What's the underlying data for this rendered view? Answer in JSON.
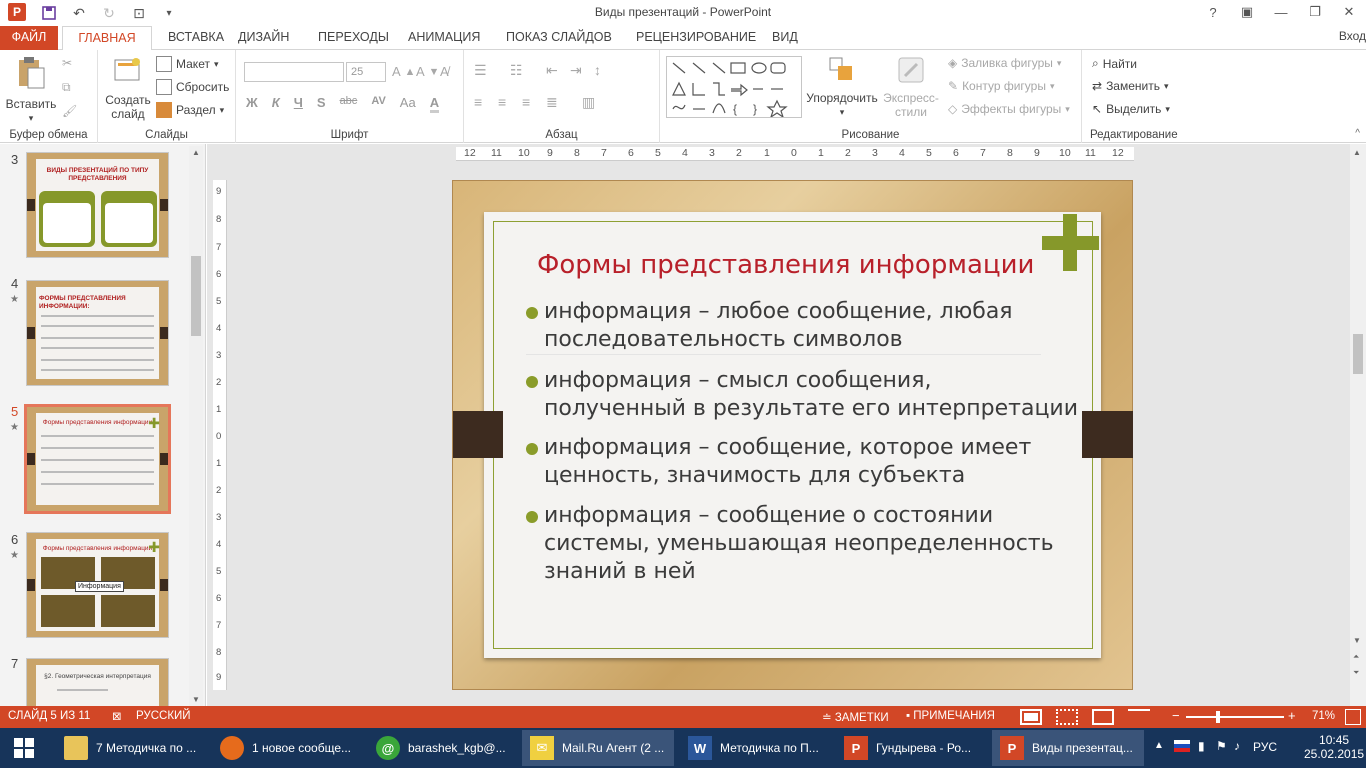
{
  "window": {
    "title": "Виды презентаций - PowerPoint",
    "signin": "Вход"
  },
  "tabs": {
    "file": "ФАЙЛ",
    "items": [
      "ГЛАВНАЯ",
      "ВСТАВКА",
      "ДИЗАЙН",
      "ПЕРЕХОДЫ",
      "АНИМАЦИЯ",
      "ПОКАЗ СЛАЙДОВ",
      "РЕЦЕНЗИРОВАНИЕ",
      "ВИД"
    ]
  },
  "ribbon": {
    "clipboard": {
      "label": "Буфер обмена",
      "paste": "Вставить"
    },
    "slides": {
      "label": "Слайды",
      "new_slide": "Создать слайд",
      "layout": "Макет",
      "reset": "Сбросить",
      "section": "Раздел"
    },
    "font": {
      "label": "Шрифт",
      "font_name": "",
      "font_size": "25",
      "bold": "Ж",
      "italic": "К",
      "underline": "Ч",
      "strike": "S",
      "abc": "abc",
      "spacing": "AV",
      "case": "Aa"
    },
    "paragraph": {
      "label": "Абзац"
    },
    "drawing": {
      "label": "Рисование",
      "arrange": "Упорядочить",
      "quick_styles": "Экспресс-стили",
      "fill": "Заливка фигуры",
      "outline": "Контур фигуры",
      "effects": "Эффекты фигуры"
    },
    "editing": {
      "label": "Редактирование",
      "find": "Найти",
      "replace": "Заменить",
      "select": "Выделить"
    }
  },
  "thumbnails": [
    {
      "num": "3",
      "title": "ВИДЫ ПРЕЗЕНТАЦИЙ ПО ТИПУ ПРЕДСТАВЛЕНИЯ",
      "star": false
    },
    {
      "num": "4",
      "title": "ФОРМЫ ПРЕДСТАВЛЕНИЯ ИНФОРМАЦИИ:",
      "star": true
    },
    {
      "num": "5",
      "title": "Формы представления информации",
      "star": true,
      "selected": true
    },
    {
      "num": "6",
      "title": "Формы представления информации",
      "star": true,
      "callout": "Информация"
    },
    {
      "num": "7",
      "title": "§2. Геометрическая интерпретация",
      "star": false
    }
  ],
  "ruler": {
    "h": [
      "12",
      "11",
      "10",
      "9",
      "8",
      "7",
      "6",
      "5",
      "4",
      "3",
      "2",
      "1",
      "0",
      "1",
      "2",
      "3",
      "4",
      "5",
      "6",
      "7",
      "8",
      "9",
      "10",
      "11",
      "12"
    ],
    "v": [
      "9",
      "8",
      "7",
      "6",
      "5",
      "4",
      "3",
      "2",
      "1",
      "0",
      "1",
      "2",
      "3",
      "4",
      "5",
      "6",
      "7",
      "8",
      "9"
    ]
  },
  "slide": {
    "title": "Формы представления информации",
    "bullets": [
      {
        "line1": "информация – любое сообщение, любая",
        "line2": "последовательность символов"
      },
      {
        "line1": "информация – смысл сообщения,",
        "line2": "полученный в результате его интерпретации"
      },
      {
        "line1": "информация – сообщение, которое имеет",
        "line2": "ценность, значимость для субъекта"
      },
      {
        "line1": "информация – сообщение о состоянии",
        "line2": "системы, уменьшающая неопределенность",
        "line3": "знаний в ней"
      }
    ],
    "accent": "#86982a",
    "title_color": "#b8202a"
  },
  "status": {
    "slide_of": "СЛАЙД 5 ИЗ 11",
    "language": "РУССКИЙ",
    "notes": "ЗАМЕТКИ",
    "comments": "ПРИМЕЧАНИЯ",
    "zoom": "71%",
    "color": "#d24726"
  },
  "taskbar": {
    "items": [
      {
        "label": "7 Методичка по ...",
        "icon": "folder-icon"
      },
      {
        "label": "1 новое сообще...",
        "icon": "firefox-icon"
      },
      {
        "label": "barashek_kgb@...",
        "icon": "mail-agent-icon"
      },
      {
        "label": "Mail.Ru Агент (2 ...",
        "icon": "envelope-icon"
      },
      {
        "label": "Методичка по П...",
        "icon": "word-icon"
      },
      {
        "label": "Гундырева - Ро...",
        "icon": "powerpoint-icon"
      },
      {
        "label": "Виды презентац...",
        "icon": "powerpoint-icon"
      }
    ],
    "lang": "РУС",
    "time": "10:45",
    "date": "25.02.2015"
  }
}
